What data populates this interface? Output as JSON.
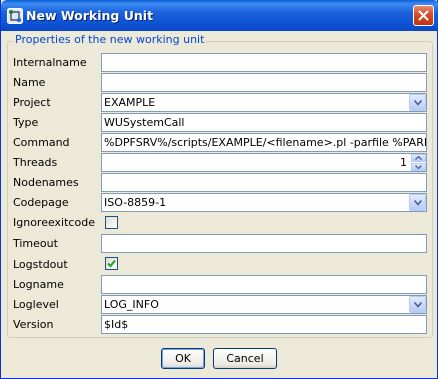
{
  "window": {
    "title": "New Working Unit"
  },
  "group": {
    "title": "Properties of the new working unit"
  },
  "fields": [
    {
      "label": "Internalname",
      "type": "text",
      "value": ""
    },
    {
      "label": "Name",
      "type": "text",
      "value": ""
    },
    {
      "label": "Project",
      "type": "combo",
      "value": "EXAMPLE"
    },
    {
      "label": "Type",
      "type": "text",
      "value": "WUSystemCall"
    },
    {
      "label": "Command",
      "type": "text",
      "value": "%DPFSRV%/scripts/EXAMPLE/<filename>.pl -parfile %PARFILENA"
    },
    {
      "label": "Threads",
      "type": "spinner",
      "value": "1"
    },
    {
      "label": "Nodenames",
      "type": "text",
      "value": ""
    },
    {
      "label": "Codepage",
      "type": "combo",
      "value": "ISO-8859-1"
    },
    {
      "label": "Ignoreexitcode",
      "type": "checkbox",
      "checked": false
    },
    {
      "label": "Timeout",
      "type": "text",
      "value": ""
    },
    {
      "label": "Logstdout",
      "type": "checkbox",
      "checked": true
    },
    {
      "label": "Logname",
      "type": "text",
      "value": ""
    },
    {
      "label": "Loglevel",
      "type": "combo",
      "value": "LOG_INFO"
    },
    {
      "label": "Version",
      "type": "text",
      "value": "$Id$"
    }
  ],
  "buttons": {
    "ok": "OK",
    "cancel": "Cancel"
  },
  "icons": {
    "app": "app-icon",
    "close": "close-icon",
    "dropdown": "chevron-down-icon"
  },
  "colors": {
    "titlebar": "#0d51d3",
    "group_title": "#0046d5",
    "field_border": "#7f9db9",
    "background": "#ece9d8"
  }
}
